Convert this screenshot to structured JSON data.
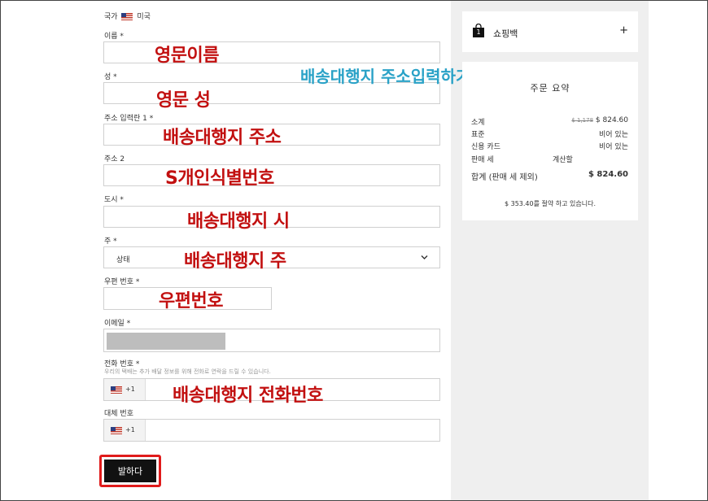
{
  "form": {
    "country_label": "국가",
    "country_value": "미국",
    "first_name_label": "이름 *",
    "last_name_label": "성 *",
    "address1_label": "주소 입력란 1 *",
    "address2_label": "주소 2",
    "city_label": "도시 *",
    "state_label": "주 *",
    "state_placeholder": "상태",
    "zip_label": "우편 번호 *",
    "email_label": "이메일 *",
    "phone_label": "전화 번호 *",
    "phone_note": "우리의 택배는 추가 배달 정보를 위해 전화로 연락을 드릴 수 있습니다.",
    "phone_code": "+1",
    "alt_phone_label": "대체 번호",
    "alt_phone_code": "+1",
    "submit_label": "발하다"
  },
  "overlays": {
    "first_name": "영문이름",
    "last_name": "영문 성",
    "address1": "배송대행지 주소",
    "address2": "S개인식별번호",
    "city": "배송대행지 시",
    "state": "배송대행지 주",
    "zip": "우편번호",
    "phone": "배송대행지 전화번호",
    "title": "배송대행지 주소입력하기"
  },
  "cart": {
    "bag_label": "쇼핑백",
    "bag_count": "1",
    "expand_symbol": "+"
  },
  "summary": {
    "title": "주문 요약",
    "subtotal_label": "소계",
    "subtotal_original": "$ 1,178",
    "subtotal_value": "$ 824.60",
    "standard_label": "표준",
    "standard_value": "비어 있는",
    "credit_label": "신용 카드",
    "credit_value": "비어 있는",
    "tax_label": "판매 세",
    "tax_value": "계산할",
    "total_label": "합계 (판매 세 제외)",
    "total_value": "$ 824.60",
    "savings_text": "$ 353.40를 절약 하고 있습니다."
  },
  "colors": {
    "overlay_red": "#c21010",
    "overlay_teal": "#2aa2c7",
    "submit_bg": "#111111",
    "submit_highlight": "#e01b1b"
  }
}
